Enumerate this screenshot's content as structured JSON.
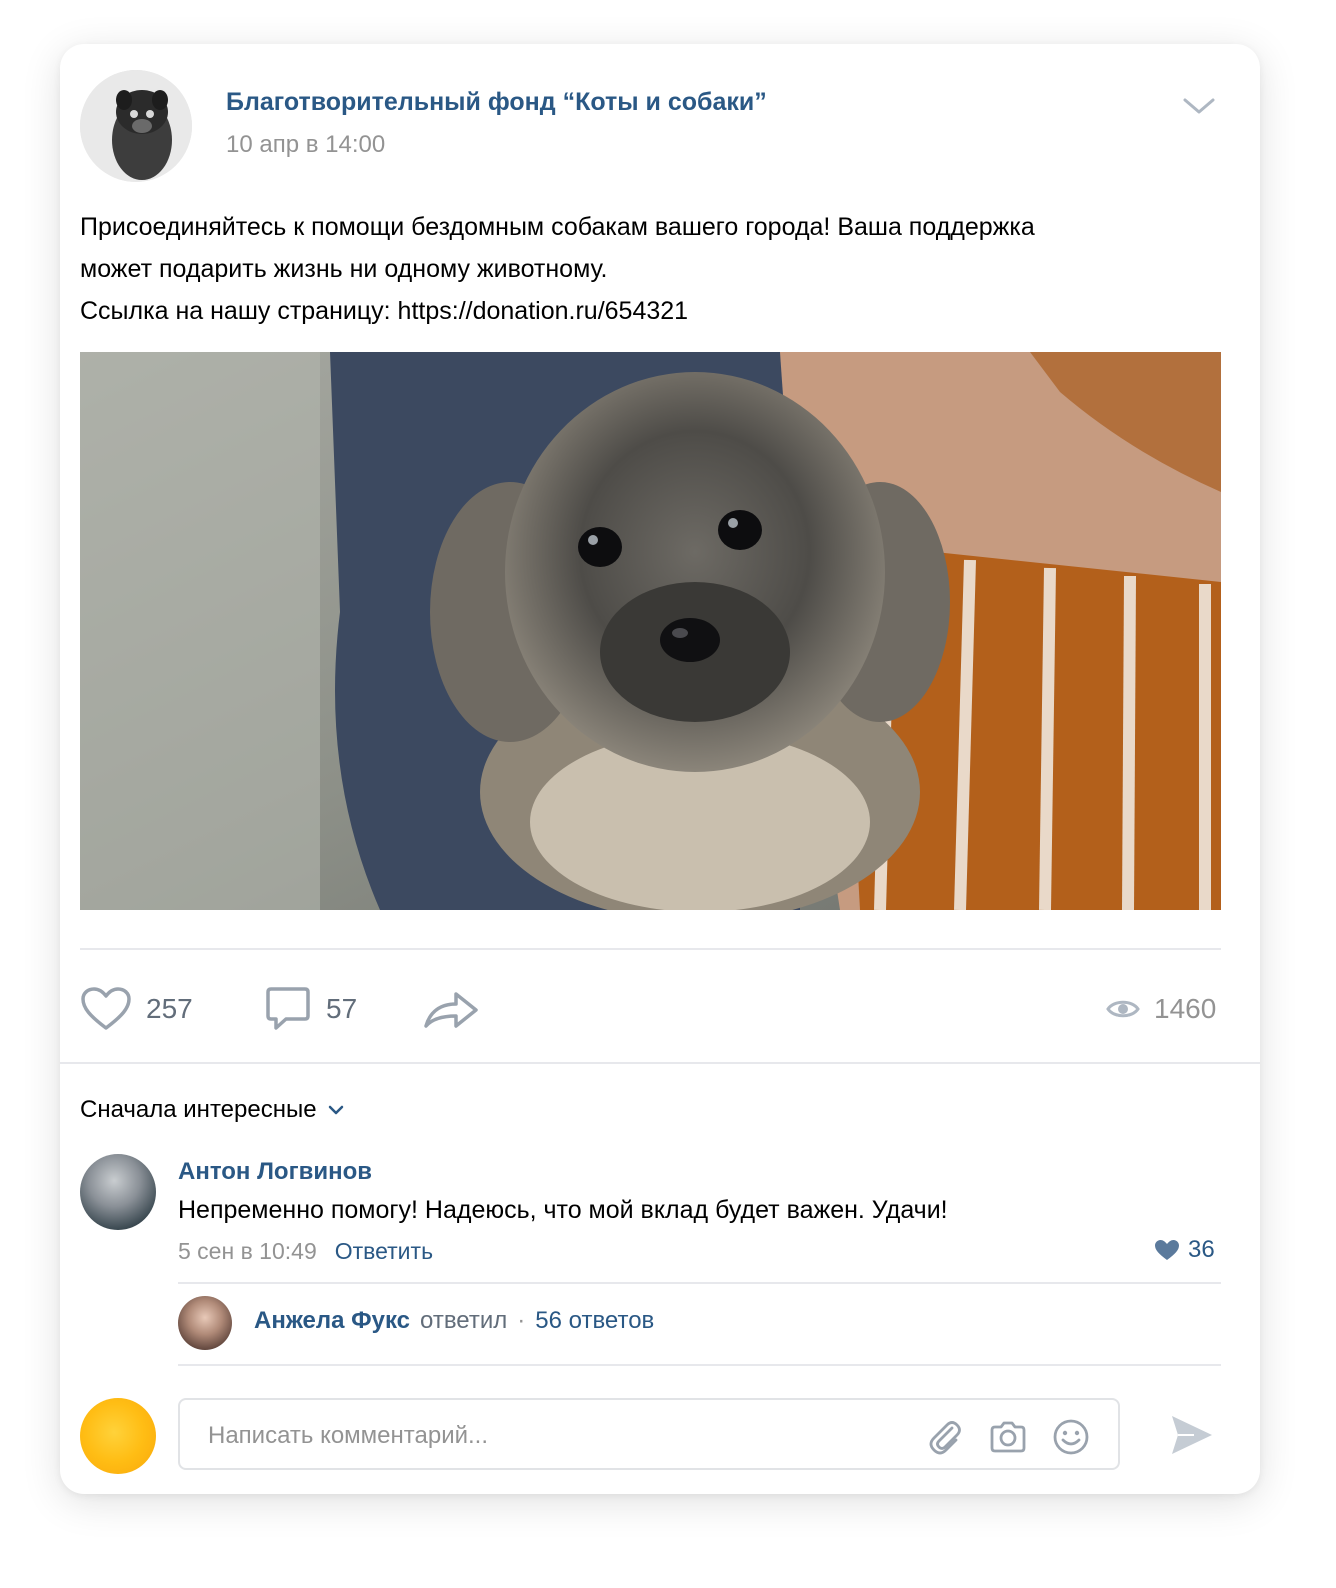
{
  "post": {
    "group_name": "Благотворительный фонд “Коты и собаки”",
    "date": "10 апр в 14:00",
    "text_lines": [
      "Присоединяйтесь к помощи бездомным собакам вашего города! Ваша поддержка",
      "может подарить жизнь ни одному животному.",
      "Ссылка на нашу страницу: https://donation.ru/654321"
    ],
    "photo_description_icon": "puppy-photo"
  },
  "actions": {
    "likes": "257",
    "comments": "57",
    "views": "1460"
  },
  "comments": {
    "sort_label": "Сначала интересные",
    "items": [
      {
        "author": "Антон Логвинов",
        "text": "Непременно помогу! Надеюсь, что мой вклад будет важен. Удачи!",
        "date": "5 сен в 10:49",
        "reply_label": "Ответить",
        "likes": "36"
      }
    ],
    "reply_thread": {
      "author": "Анжела Фукс",
      "verb": "ответил",
      "separator": "·",
      "count_label": "56 ответов"
    },
    "input": {
      "placeholder": "Написать комментарий..."
    }
  },
  "colors": {
    "link": "#2a5885",
    "muted": "#939393",
    "icon": "#99a2ad"
  }
}
